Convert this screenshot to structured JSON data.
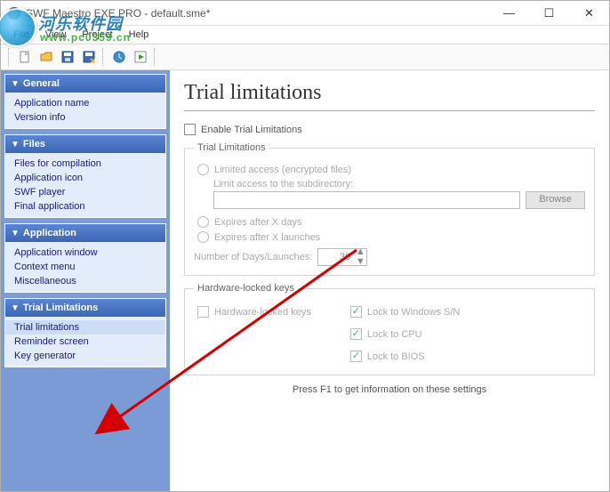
{
  "window": {
    "title": "SWF Maestro EXE PRO - default.sme*",
    "min": "—",
    "max": "☐",
    "close": "✕"
  },
  "watermark": {
    "cn": "河乐软件园",
    "url": "www.pc0359.cn"
  },
  "menu": {
    "file": "File",
    "view": "View",
    "project": "Project",
    "help": "Help"
  },
  "sidebar": {
    "general": {
      "title": "General",
      "items": [
        "Application name",
        "Version info"
      ]
    },
    "files": {
      "title": "Files",
      "items": [
        "Files for compilation",
        "Application icon",
        "SWF player",
        "Final application"
      ]
    },
    "application": {
      "title": "Application",
      "items": [
        "Application window",
        "Context menu",
        "Miscellaneous"
      ]
    },
    "trial": {
      "title": "Trial Limitations",
      "items": [
        "Trial limitations",
        "Reminder screen",
        "Key generator"
      ]
    }
  },
  "main": {
    "heading": "Trial limitations",
    "enable": "Enable Trial Limitations",
    "fs1": {
      "legend": "Trial Limitations",
      "opt1": "Limited access (encrypted files)",
      "subdir": "Limit access to the subdirectory:",
      "browse": "Browse",
      "opt2": "Expires after X days",
      "opt3": "Expires after X launches",
      "numlabel": "Number of Days/Launches:",
      "numval": "30"
    },
    "fs2": {
      "legend": "Hardware-locked keys",
      "hwk": "Hardware-locked keys",
      "win": "Lock to Windows S/N",
      "cpu": "Lock to CPU",
      "bios": "Lock to BIOS"
    },
    "hint": "Press F1 to get information on these settings"
  }
}
